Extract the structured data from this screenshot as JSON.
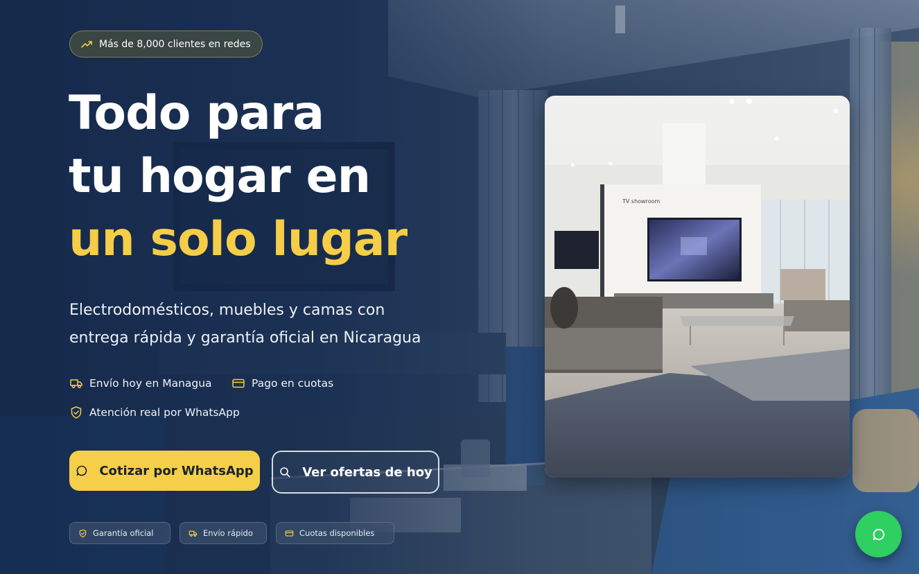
{
  "hero": {
    "badge": "Más de 8,000 clientes en redes",
    "headline_line1": "Todo para",
    "headline_line2": "tu hogar en",
    "headline_accent": "un solo lugar",
    "subtitle_line1": "Electrodomésticos, muebles y camas con",
    "subtitle_line2": "entrega rápida y garantía oficial en Nicaragua"
  },
  "features": [
    {
      "label": "Envío hoy en Managua",
      "icon": "truck-icon"
    },
    {
      "label": "Pago en cuotas",
      "icon": "credit-card-icon"
    },
    {
      "label": "Atención real por WhatsApp",
      "icon": "shield-check-icon"
    }
  ],
  "buttons": {
    "primary": "Cotizar por WhatsApp",
    "secondary": "Ver ofertas de hoy"
  },
  "chips": [
    {
      "label": "Garantía oficial",
      "icon": "shield-check-icon"
    },
    {
      "label": "Envío rápido",
      "icon": "truck-icon"
    },
    {
      "label": "Cuotas disponibles",
      "icon": "credit-card-icon"
    }
  ],
  "showroom": {
    "sign_text": "TV showroom"
  },
  "colors": {
    "accent": "#f5cd47",
    "background": "#1e3556",
    "whatsapp": "#2fcf62"
  }
}
